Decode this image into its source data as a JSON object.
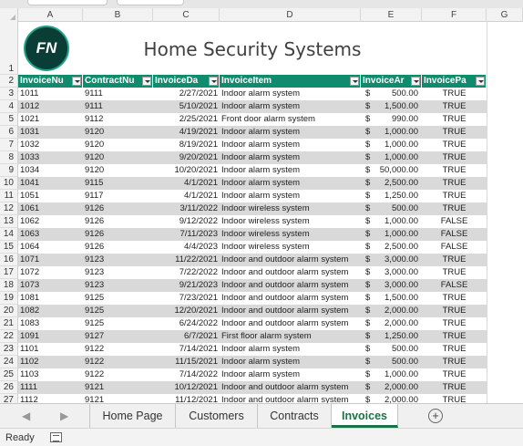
{
  "columns": [
    "A",
    "B",
    "C",
    "D",
    "E",
    "F",
    "G"
  ],
  "title": "Home Security Systems",
  "logo_text": "FN",
  "headers": [
    "InvoiceNu",
    "ContractNu",
    "InvoiceDa",
    "InvoiceItem",
    "InvoiceAr",
    "InvoicePa"
  ],
  "rows": [
    {
      "n": "3",
      "inv": "1011",
      "con": "9111",
      "date": "2/27/2021",
      "item": "Indoor alarm system",
      "amt": "500.00",
      "paid": "TRUE"
    },
    {
      "n": "4",
      "inv": "1012",
      "con": "9111",
      "date": "5/10/2021",
      "item": "Indoor alarm system",
      "amt": "1,500.00",
      "paid": "TRUE"
    },
    {
      "n": "5",
      "inv": "1021",
      "con": "9112",
      "date": "2/25/2021",
      "item": "Front door alarm system",
      "amt": "990.00",
      "paid": "TRUE"
    },
    {
      "n": "6",
      "inv": "1031",
      "con": "9120",
      "date": "4/19/2021",
      "item": "Indoor alarm system",
      "amt": "1,000.00",
      "paid": "TRUE"
    },
    {
      "n": "7",
      "inv": "1032",
      "con": "9120",
      "date": "8/19/2021",
      "item": "Indoor alarm system",
      "amt": "1,000.00",
      "paid": "TRUE"
    },
    {
      "n": "8",
      "inv": "1033",
      "con": "9120",
      "date": "9/20/2021",
      "item": "Indoor alarm system",
      "amt": "1,000.00",
      "paid": "TRUE"
    },
    {
      "n": "9",
      "inv": "1034",
      "con": "9120",
      "date": "10/20/2021",
      "item": "Indoor alarm system",
      "amt": "50,000.00",
      "paid": "TRUE"
    },
    {
      "n": "10",
      "inv": "1041",
      "con": "9115",
      "date": "4/1/2021",
      "item": "Indoor alarm system",
      "amt": "2,500.00",
      "paid": "TRUE"
    },
    {
      "n": "11",
      "inv": "1051",
      "con": "9117",
      "date": "4/1/2021",
      "item": "Indoor alarm system",
      "amt": "1,250.00",
      "paid": "TRUE"
    },
    {
      "n": "12",
      "inv": "1061",
      "con": "9126",
      "date": "3/11/2022",
      "item": "Indoor wireless system",
      "amt": "500.00",
      "paid": "TRUE"
    },
    {
      "n": "13",
      "inv": "1062",
      "con": "9126",
      "date": "9/12/2022",
      "item": "Indoor wireless system",
      "amt": "1,000.00",
      "paid": "FALSE"
    },
    {
      "n": "14",
      "inv": "1063",
      "con": "9126",
      "date": "7/11/2023",
      "item": "Indoor wireless system",
      "amt": "1,000.00",
      "paid": "FALSE"
    },
    {
      "n": "15",
      "inv": "1064",
      "con": "9126",
      "date": "4/4/2023",
      "item": "Indoor wireless system",
      "amt": "2,500.00",
      "paid": "FALSE"
    },
    {
      "n": "16",
      "inv": "1071",
      "con": "9123",
      "date": "11/22/2021",
      "item": "Indoor and outdoor alarm system",
      "amt": "3,000.00",
      "paid": "TRUE"
    },
    {
      "n": "17",
      "inv": "1072",
      "con": "9123",
      "date": "7/22/2022",
      "item": "Indoor and outdoor alarm system",
      "amt": "3,000.00",
      "paid": "TRUE"
    },
    {
      "n": "18",
      "inv": "1073",
      "con": "9123",
      "date": "9/21/2023",
      "item": "Indoor and outdoor alarm system",
      "amt": "3,000.00",
      "paid": "FALSE"
    },
    {
      "n": "19",
      "inv": "1081",
      "con": "9125",
      "date": "7/23/2021",
      "item": "Indoor and outdoor alarm system",
      "amt": "1,500.00",
      "paid": "TRUE"
    },
    {
      "n": "20",
      "inv": "1082",
      "con": "9125",
      "date": "12/20/2021",
      "item": "Indoor and outdoor alarm system",
      "amt": "2,000.00",
      "paid": "TRUE"
    },
    {
      "n": "21",
      "inv": "1083",
      "con": "9125",
      "date": "6/24/2022",
      "item": "Indoor and outdoor alarm system",
      "amt": "2,000.00",
      "paid": "TRUE"
    },
    {
      "n": "22",
      "inv": "1091",
      "con": "9127",
      "date": "6/7/2021",
      "item": "First floor alarm system",
      "amt": "1,250.00",
      "paid": "TRUE"
    },
    {
      "n": "23",
      "inv": "1101",
      "con": "9122",
      "date": "7/14/2021",
      "item": "Indoor alarm system",
      "amt": "500.00",
      "paid": "TRUE"
    },
    {
      "n": "24",
      "inv": "1102",
      "con": "9122",
      "date": "11/15/2021",
      "item": "Indoor alarm system",
      "amt": "500.00",
      "paid": "TRUE"
    },
    {
      "n": "25",
      "inv": "1103",
      "con": "9122",
      "date": "7/14/2022",
      "item": "Indoor alarm system",
      "amt": "1,000.00",
      "paid": "TRUE"
    },
    {
      "n": "26",
      "inv": "1111",
      "con": "9121",
      "date": "10/12/2021",
      "item": "Indoor and outdoor alarm system",
      "amt": "2,000.00",
      "paid": "TRUE"
    },
    {
      "n": "27",
      "inv": "1112",
      "con": "9121",
      "date": "11/12/2021",
      "item": "Indoor and outdoor alarm system",
      "amt": "2,000.00",
      "paid": "TRUE"
    }
  ],
  "currency_symbol": "$",
  "sheet_tabs": [
    "Home Page",
    "Customers",
    "Contracts",
    "Invoices"
  ],
  "active_tab": "Invoices",
  "add_sheet_label": "+",
  "status": "Ready",
  "colors": {
    "header_green": "#0f8c6e",
    "active_tab": "#1e7145",
    "band": "#d9d9d9"
  }
}
